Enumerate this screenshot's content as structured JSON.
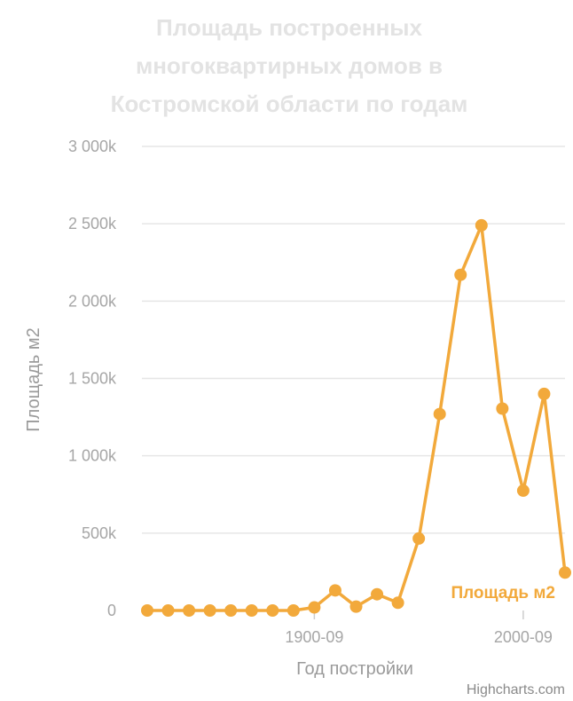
{
  "chart_data": {
    "type": "line",
    "title_lines": [
      "Площадь построенных",
      "многоквартирных домов в",
      "Костромской области по годам"
    ],
    "xlabel": "Год постройки",
    "ylabel": "Площадь м2",
    "y_tick_labels": [
      "0",
      "500k",
      "1 000k",
      "1 500k",
      "2 000k",
      "2 500k",
      "3 000k"
    ],
    "y_ticks": [
      0,
      500000,
      1000000,
      1500000,
      2000000,
      2500000,
      3000000
    ],
    "ylim": [
      0,
      3000000
    ],
    "x_tick_labels": [
      "1900-09",
      "2000-09"
    ],
    "x_tick_positions": [
      8,
      18
    ],
    "grid": true,
    "series": [
      {
        "name": "Площадь м2",
        "color": "#f2a93b",
        "values": [
          0,
          0,
          0,
          0,
          0,
          0,
          0,
          0,
          20000,
          130000,
          25000,
          105000,
          50000,
          465000,
          1270000,
          2170000,
          2490000,
          1305000,
          775000,
          1400000,
          245000
        ]
      }
    ],
    "credits": "Highcharts.com"
  }
}
